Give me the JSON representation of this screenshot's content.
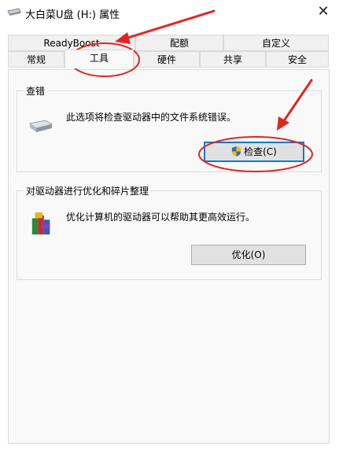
{
  "window": {
    "title": "大白菜U盘 (H:) 属性",
    "close_glyph": "✕"
  },
  "tabs_row_top": [
    {
      "label": "ReadyBoost"
    },
    {
      "label": "配额"
    },
    {
      "label": "自定义"
    }
  ],
  "tabs_row_bottom": [
    {
      "label": "常规"
    },
    {
      "label": "工具",
      "active": true
    },
    {
      "label": "硬件"
    },
    {
      "label": "共享"
    },
    {
      "label": "安全"
    }
  ],
  "error_check": {
    "group_title": "查错",
    "description": "此选项将检查驱动器中的文件系统错误。",
    "button_label": "检查(C)",
    "icon": "drive-icon"
  },
  "optimize": {
    "group_title": "对驱动器进行优化和碎片整理",
    "description": "优化计算机的驱动器可以帮助其更高效运行。",
    "button_label": "优化(O)",
    "icon": "defrag-icon"
  },
  "annotations": {
    "color": "#e0261f",
    "arrow_count": 2,
    "ellipse_count": 2
  }
}
